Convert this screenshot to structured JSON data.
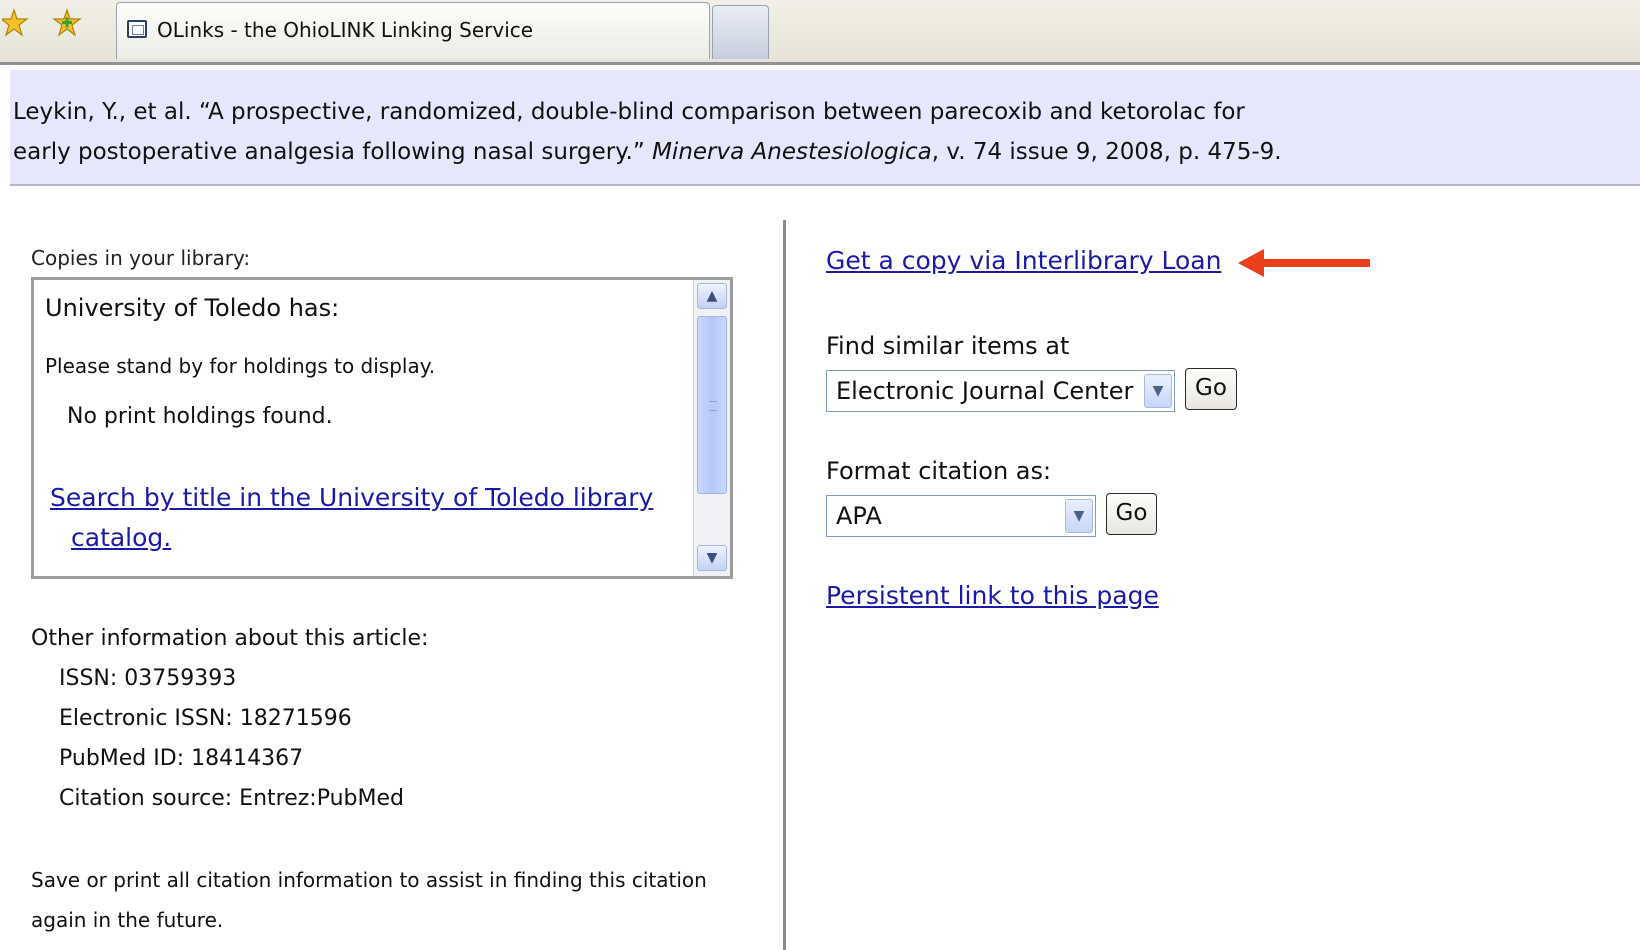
{
  "browser": {
    "tab_title": "OLinks - the OhioLINK Linking Service"
  },
  "citation": {
    "authors_title_part": "Leykin, Y., et al. “A prospective, randomized, double-blind comparison between parecoxib and ketorolac for",
    "title_cont": "early postoperative analgesia following nasal surgery.”",
    "journal": "Minerva Anestesiologica",
    "details": ", v. 74 issue 9, 2008, p. 475-9."
  },
  "holdings": {
    "label": "Copies in your library:",
    "title": "University of Toledo has:",
    "standby": "Please stand by for holdings to display.",
    "no_print": "No print holdings found.",
    "search_link_line1": "Search by title in the University of Toledo library",
    "search_link_line2": "catalog."
  },
  "other_info": {
    "label": "Other information about this article:",
    "issn": "ISSN: 03759393",
    "eissn": "Electronic ISSN: 18271596",
    "pubmed": "PubMed ID: 18414367",
    "source": "Citation source: Entrez:PubMed"
  },
  "save_note": "Save or print all citation information to assist in finding this citation again in the future.",
  "actions": {
    "ill_link": "Get a copy via Interlibrary Loan",
    "similar_label": "Find similar items at",
    "similar_selected": "Electronic Journal Center",
    "go_label": "Go",
    "format_label": "Format citation as:",
    "format_selected": "APA",
    "persistent_link": "Persistent link to this page"
  },
  "colors": {
    "link": "#1a1aa6",
    "banner_bg": "#e6e7fb",
    "arrow": "#e8401c"
  },
  "icons": [
    "star-icon",
    "bookmarks-star-icon",
    "page-favicon-icon",
    "chevron-down-icon",
    "scroll-up-icon",
    "scroll-down-icon",
    "red-arrow-icon"
  ]
}
